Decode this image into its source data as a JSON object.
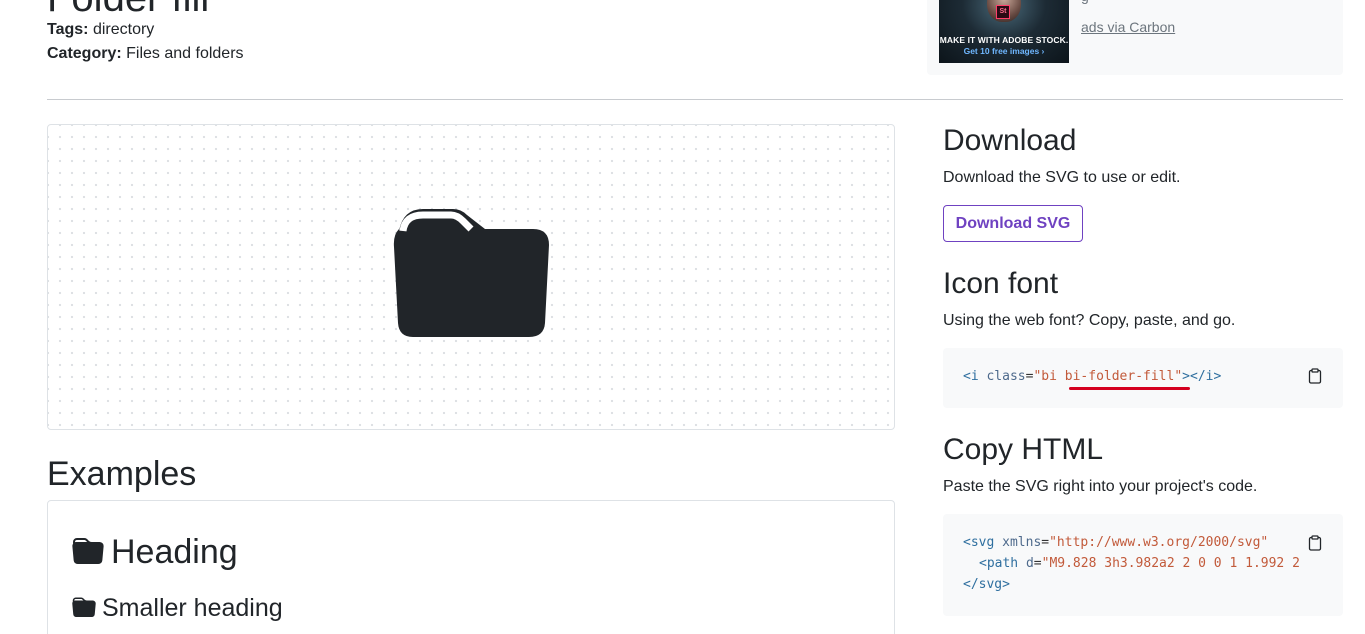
{
  "page": {
    "title": "Folder fill",
    "tags_label": "Tags:",
    "tags_value": "directory",
    "category_label": "Category:",
    "category_value": "Files and folders"
  },
  "ad": {
    "image_text_1": "MAKE IT WITH ADOBE STOCK.",
    "image_text_2": "Get 10 free images ›",
    "image_badge": "St",
    "line_partial": "g",
    "via_link": "ads via Carbon"
  },
  "examples": {
    "heading": "Examples",
    "heading_example": "Heading",
    "smaller_heading_example": "Smaller heading"
  },
  "download": {
    "heading": "Download",
    "description": "Download the SVG to use or edit.",
    "button_label": "Download SVG"
  },
  "icon_font": {
    "heading": "Icon font",
    "description": "Using the web font? Copy, paste, and go.",
    "code_open_tag": "<i",
    "code_attr": "class",
    "code_eq": "=",
    "code_value_prefix": "\"bi ",
    "code_value_highlight": "bi-folder-fill",
    "code_value_suffix": "\"",
    "code_close": "></i>"
  },
  "copy_html": {
    "heading": "Copy HTML",
    "description": "Paste the SVG right into your project's code.",
    "line1_tag": "<svg",
    "line1_attr": "xmlns",
    "line1_value": "\"http://www.w3.org/2000/svg\"",
    "line2_tag": "<path",
    "line2_attr": "d",
    "line2_value": "\"M9.828 3h3.982a2 2 0 0 1 1.992 2",
    "line3": "</svg>"
  },
  "icons": {
    "preview": "folder-fill-icon",
    "clipboard": "clipboard-icon"
  },
  "colors": {
    "accent": "#6f42c1",
    "highlight_underline": "#d4001f",
    "code_bg": "#f8f9fa"
  }
}
